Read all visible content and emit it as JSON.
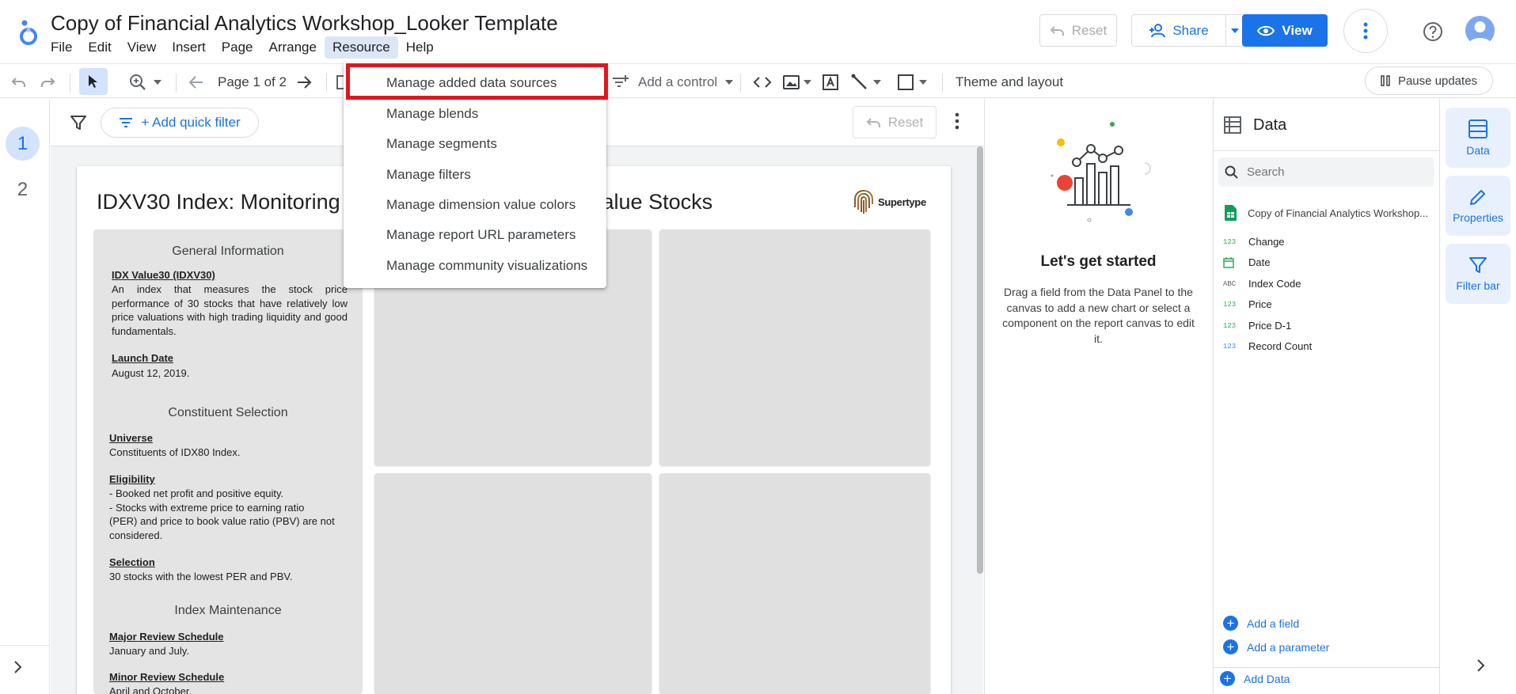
{
  "header": {
    "title": "Copy of Financial Analytics Workshop_Looker Template",
    "menu": [
      "File",
      "Edit",
      "View",
      "Insert",
      "Page",
      "Arrange",
      "Resource",
      "Help"
    ],
    "reset_label": "Reset",
    "share_label": "Share",
    "view_label": "View"
  },
  "toolbar": {
    "page_indicator": "Page 1 of 2",
    "add_control_label": "Add a control",
    "theme_label": "Theme and layout",
    "pause_label": "Pause updates"
  },
  "pages": [
    "1",
    "2"
  ],
  "canvas": {
    "add_filter_label": "+ Add quick filter",
    "reset_label": "Reset"
  },
  "report": {
    "title_left": "IDXV30 Index: Monitoring",
    "title_right": "g Value Stocks",
    "logo_text": "Supertype",
    "general_info_title": "General Information",
    "idx_head": "IDX Value30 (IDXV30)",
    "idx_text": "An index that measures the stock price performance of 30 stocks that have relatively low price valuations with high trading liquidity and good fundamentals.",
    "launch_head": "Launch Date",
    "launch_text": "August 12, 2019.",
    "constituent_title": "Constituent Selection",
    "universe_head": "Universe",
    "universe_text": "Constituents of IDX80 Index.",
    "eligibility_head": "Eligibility",
    "eligibility_line1": "- Booked net profit and positive equity.",
    "eligibility_line2": "- Stocks with extreme price to earning ratio",
    "eligibility_line3": "(PER) and price to book value ratio (PBV) are not",
    "eligibility_line4": "considered.",
    "selection_head": "Selection",
    "selection_text": "30 stocks with the lowest PER and PBV.",
    "maintenance_title": "Index Maintenance",
    "major_head": "Major Review Schedule",
    "major_text": "January and July.",
    "minor_head": "Minor Review Schedule",
    "minor_text": "April and October."
  },
  "resource_menu": {
    "items": [
      "Manage added data sources",
      "Manage blends",
      "Manage segments",
      "Manage filters",
      "Manage dimension value colors",
      "Manage report URL parameters",
      "Manage community visualizations"
    ]
  },
  "get_started": {
    "title": "Let's get started",
    "description": "Drag a field from the Data Panel to the canvas to add a new chart or select a component on the report canvas to edit it."
  },
  "data_panel": {
    "title": "Data",
    "search_placeholder": "Search",
    "source_name": "Copy of Financial Analytics Workshop...",
    "fields": [
      {
        "type": "123",
        "name": "Change"
      },
      {
        "type": "date",
        "name": "Date"
      },
      {
        "type": "ABC",
        "name": "Index Code"
      },
      {
        "type": "123",
        "name": "Price"
      },
      {
        "type": "123",
        "name": "Price D-1"
      },
      {
        "type": "123",
        "name": "Record Count"
      }
    ],
    "add_field_label": "Add a field",
    "add_parameter_label": "Add a parameter",
    "add_data_label": "Add Data"
  },
  "right_rail": {
    "data_label": "Data",
    "properties_label": "Properties",
    "filter_bar_label": "Filter bar"
  },
  "colors": {
    "accent": "#1a73e8",
    "highlight": "#e1161c",
    "chart_placeholder": "#e0e0e0"
  }
}
